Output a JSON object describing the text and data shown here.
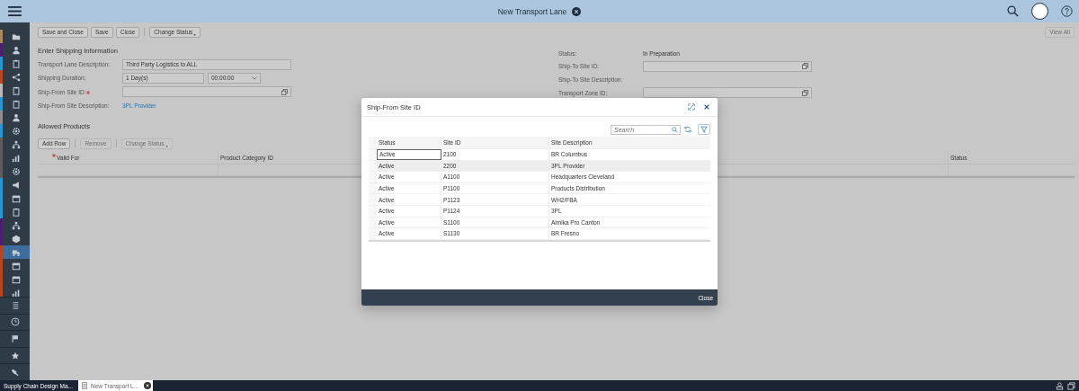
{
  "header": {
    "title": "New Transport Lane"
  },
  "sidebar": {
    "items": [
      {
        "color": "#a8885c",
        "selected": false
      },
      {
        "color": "#4a1e6a",
        "selected": false
      },
      {
        "color": "#2b95cf",
        "selected": false
      },
      {
        "color": "#b5461f",
        "selected": false
      },
      {
        "color": "#b9b9b9",
        "selected": false
      },
      {
        "color": "#2b95cf",
        "selected": false
      },
      {
        "color": "#8c8c8c",
        "selected": false
      },
      {
        "color": "#2b95cf",
        "selected": false
      },
      {
        "color": "#5d5d5d",
        "selected": false
      },
      {
        "color": "#5d5d5d",
        "selected": false
      },
      {
        "color": "#5d5d5d",
        "selected": false
      },
      {
        "color": "#2b95cf",
        "selected": false
      },
      {
        "color": "#2b95cf",
        "selected": false
      },
      {
        "color": "#2b95cf",
        "selected": false
      },
      {
        "color": "#4a1e6a",
        "selected": false
      },
      {
        "color": "#4a1e6a",
        "selected": false
      },
      {
        "color": "#b5461f",
        "selected": true
      },
      {
        "color": "#b5461f",
        "selected": false
      },
      {
        "color": "#b5461f",
        "selected": false
      },
      {
        "color": "#b5461f",
        "selected": false
      }
    ]
  },
  "toolbar": {
    "buttons": [
      {
        "label": "Save and Close",
        "kind": "plain"
      },
      {
        "label": "Save",
        "kind": "plain"
      },
      {
        "label": "Close",
        "kind": "plain"
      },
      {
        "label": "Change Status",
        "kind": "menu"
      }
    ],
    "view_all": {
      "label": "View All",
      "disabled": true
    }
  },
  "shipping": {
    "heading": "Enter Shipping Information",
    "fields": [
      {
        "label": "Transport Lane Description:",
        "kind": "text",
        "required": false,
        "value": "Third Party Logistics to ALL"
      },
      {
        "label": "Shipping Duration:",
        "kind": "duration",
        "required": false,
        "value": "1 Day(s)",
        "time": "00:00:00"
      },
      {
        "label": "Ship-From Site ID:",
        "kind": "lookup",
        "required": true
      },
      {
        "label": "Ship-From Site Description:",
        "kind": "link",
        "required": false,
        "value": "3PL Provider"
      }
    ]
  },
  "side_fields": [
    {
      "label": "Status:",
      "kind": "static",
      "value": "In Preparation"
    },
    {
      "label": "Ship-To Site ID:",
      "kind": "lookup"
    },
    {
      "label": "Ship-To Site Description:",
      "kind": "static"
    },
    {
      "label": "Transport Zone ID:",
      "kind": "lookup"
    }
  ],
  "allowed_products": {
    "heading": "Allowed Products",
    "buttons": [
      {
        "label": "Add Row",
        "kind": "plain",
        "disabled": false
      },
      {
        "label": "Remove",
        "kind": "plain",
        "disabled": true
      },
      {
        "label": "Change Status",
        "kind": "menu",
        "disabled": true
      }
    ],
    "columns": [
      {
        "label": "Valid For",
        "required": true
      },
      {
        "label": "Product Category ID",
        "required": false
      },
      {
        "label": "Status",
        "required": false
      }
    ]
  },
  "dialog": {
    "title": "Ship-From Site ID",
    "search": {
      "placeholder": "Search"
    },
    "columns": [
      "Status",
      "Site ID",
      "Site Description"
    ],
    "rows": [
      {
        "cells": [
          "Active",
          "2100",
          "BR Columbus"
        ],
        "selected": false,
        "focused": true
      },
      {
        "cells": [
          "Active",
          "2200",
          "3PL Provider"
        ],
        "selected": true,
        "focused": false
      },
      {
        "cells": [
          "Active",
          "A1100",
          "Headquarters Cleveland"
        ],
        "selected": false,
        "focused": false
      },
      {
        "cells": [
          "Active",
          "P1100",
          "Products Distribution"
        ],
        "selected": false,
        "focused": false
      },
      {
        "cells": [
          "Active",
          "P1123",
          "WH2/FBA"
        ],
        "selected": false,
        "focused": false
      },
      {
        "cells": [
          "Active",
          "P1124",
          "3PL"
        ],
        "selected": false,
        "focused": false
      },
      {
        "cells": [
          "Active",
          "S1100",
          "Almika Pro Canton"
        ],
        "selected": false,
        "focused": false
      },
      {
        "cells": [
          "Active",
          "S1130",
          "BR Fresno"
        ],
        "selected": false,
        "focused": false
      }
    ],
    "footer_button": "Close"
  },
  "taskbar": {
    "items": [
      {
        "label": "Supply Chain Design Ma...",
        "kind": "app",
        "selected": false
      },
      {
        "label": "New Transport L...",
        "kind": "document",
        "selected": true
      }
    ]
  }
}
